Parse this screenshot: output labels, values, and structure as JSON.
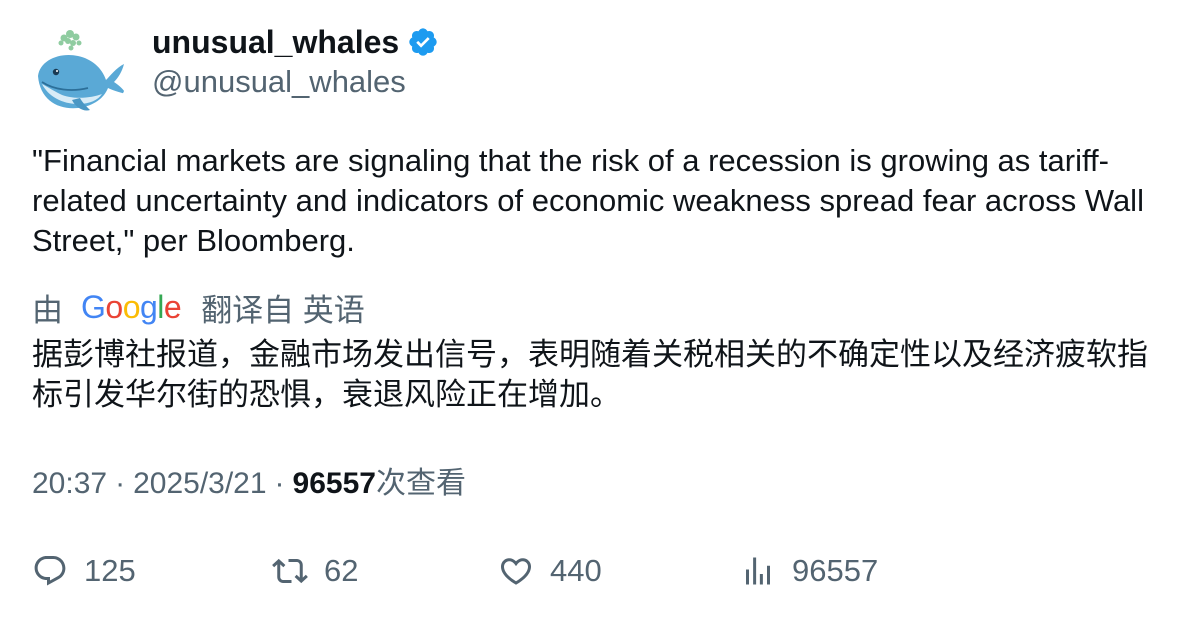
{
  "author": {
    "name": "unusual_whales",
    "handle": "@unusual_whales",
    "verified_color": "#1d9bf0"
  },
  "tweet": {
    "text": "\"Financial markets are signaling that the risk of a recession is growing as tariff-related uncertainty and indicators of economic weakness spread fear across Wall Street,\" per Bloomberg."
  },
  "translation": {
    "prefix": "由",
    "provider_letters": [
      "G",
      "o",
      "o",
      "g",
      "l",
      "e"
    ],
    "suffix": "翻译自 英语",
    "text": "据彭博社报道，金融市场发出信号，表明随着关税相关的不确定性以及经济疲软指标引发华尔街的恐惧，衰退风险正在增加。"
  },
  "meta": {
    "time": "20:37",
    "separator": "·",
    "date": "2025/3/21",
    "views_count": "96557",
    "views_label": "次查看"
  },
  "actions": {
    "reply_count": "125",
    "retweet_count": "62",
    "like_count": "440",
    "views_count": "96557"
  },
  "icons": {
    "reply": "reply-icon",
    "retweet": "retweet-icon",
    "like": "heart-icon",
    "views": "analytics-icon",
    "verified": "verified-badge-icon"
  },
  "colors": {
    "text_primary": "#0f1419",
    "text_secondary": "#536471",
    "brand_blue": "#1d9bf0"
  }
}
